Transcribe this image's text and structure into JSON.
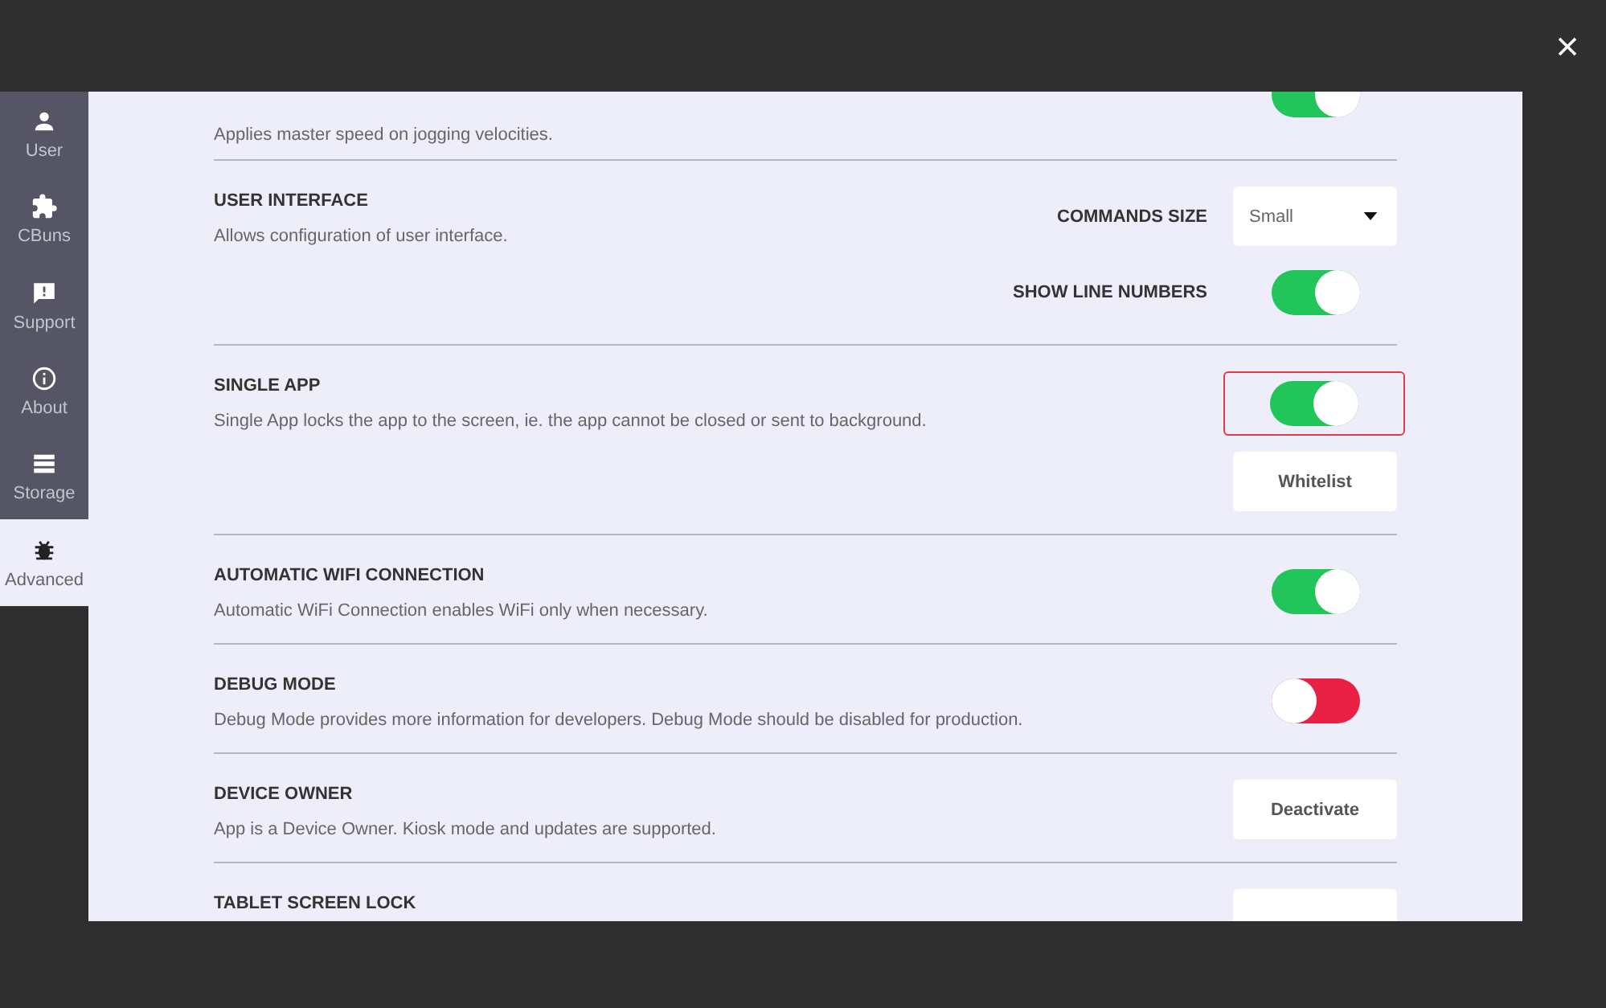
{
  "sidebar": {
    "items": [
      {
        "label": "User",
        "selected": false
      },
      {
        "label": "CBuns",
        "selected": false
      },
      {
        "label": "Support",
        "selected": false
      },
      {
        "label": "About",
        "selected": false
      },
      {
        "label": "Storage",
        "selected": false
      },
      {
        "label": "Advanced",
        "selected": true
      }
    ]
  },
  "sections": [
    {
      "description": "Applies master speed on jogging velocities.",
      "controls": [
        {
          "kind": "toggle",
          "on": true,
          "highlighted": false
        }
      ]
    },
    {
      "title": "USER INTERFACE",
      "description": "Allows configuration of user interface.",
      "controls": [
        {
          "kind": "dropdown",
          "label": "COMMANDS SIZE",
          "value": "Small",
          "highlighted": false
        },
        {
          "kind": "toggle",
          "label": "SHOW LINE NUMBERS",
          "on": true,
          "highlighted": false
        }
      ]
    },
    {
      "title": "SINGLE APP",
      "description": "Single App locks the app to the screen, ie. the app cannot be closed or sent to background.",
      "controls": [
        {
          "kind": "toggle",
          "on": true,
          "highlighted": true
        },
        {
          "kind": "button",
          "text": "Whitelist",
          "highlighted": false
        }
      ]
    },
    {
      "title": "AUTOMATIC WIFI CONNECTION",
      "description": "Automatic WiFi Connection enables WiFi only when necessary.",
      "controls": [
        {
          "kind": "toggle",
          "on": true,
          "highlighted": false
        }
      ]
    },
    {
      "title": "DEBUG MODE",
      "description": "Debug Mode provides more information for developers. Debug Mode should be disabled for production.",
      "controls": [
        {
          "kind": "toggle",
          "on": false,
          "highlighted": false
        }
      ]
    },
    {
      "title": "DEVICE OWNER",
      "description": "App is a Device Owner. Kiosk mode and updates are supported.",
      "controls": [
        {
          "kind": "button",
          "text": "Deactivate",
          "highlighted": false
        }
      ]
    },
    {
      "title": "TABLET SCREEN LOCK",
      "controls": [
        {
          "kind": "button",
          "highlighted": false
        }
      ]
    }
  ]
}
